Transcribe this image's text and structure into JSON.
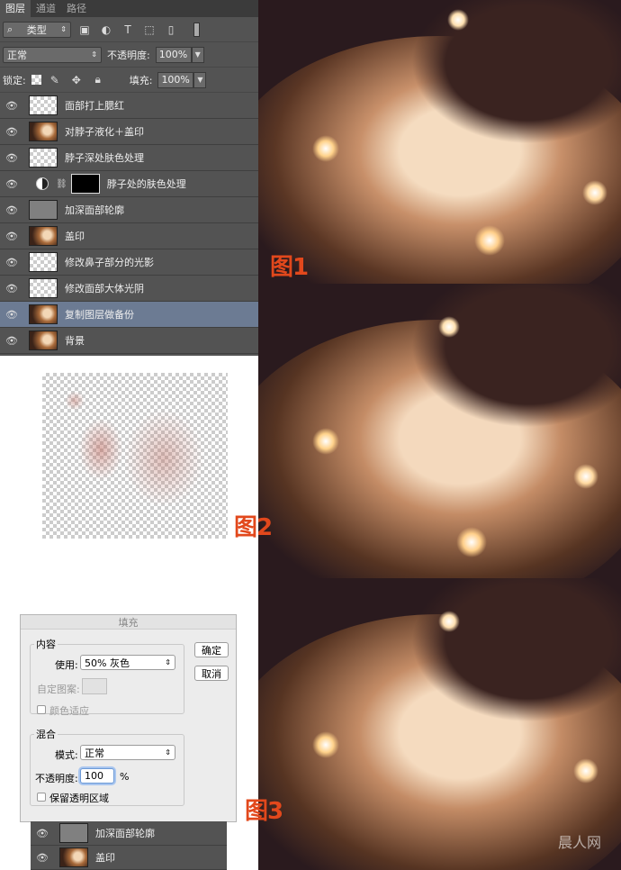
{
  "layers_panel": {
    "tabs": [
      "图层",
      "通道",
      "路径"
    ],
    "filter_kind": "类型",
    "blend_mode": "正常",
    "opacity_label": "不透明度:",
    "opacity_value": "100%",
    "lock_label": "锁定:",
    "fill_label": "填充:",
    "fill_value": "100%",
    "layers": [
      {
        "name": "面部打上腮红",
        "thumb": "transparent"
      },
      {
        "name": "对脖子液化＋盖印",
        "thumb": "photo"
      },
      {
        "name": "脖子深处肤色处理",
        "thumb": "transparent"
      },
      {
        "name": "脖子处的肤色处理",
        "thumb": "adjustment-mask"
      },
      {
        "name": "加深面部轮廓",
        "thumb": "gray"
      },
      {
        "name": "盖印",
        "thumb": "photo"
      },
      {
        "name": "修改鼻子部分的光影",
        "thumb": "transparent"
      },
      {
        "name": "修改面部大体光阴",
        "thumb": "transparent"
      },
      {
        "name": "复制图层做备份",
        "thumb": "photo",
        "selected": true
      },
      {
        "name": "背景",
        "thumb": "photo"
      }
    ]
  },
  "captions": {
    "fig1": "图1",
    "fig2": "图2",
    "fig3": "图3"
  },
  "fill_dialog": {
    "title": "填充",
    "content_legend": "内容",
    "use_label": "使用:",
    "use_value": "50% 灰色",
    "custom_pattern_label": "自定图案:",
    "color_adapt_label": "颜色适应",
    "blend_legend": "混合",
    "mode_label": "模式:",
    "mode_value": "正常",
    "opacity_label": "不透明度:",
    "opacity_value": "100",
    "percent": "%",
    "preserve_label": "保留透明区域",
    "ok": "确定",
    "cancel": "取消"
  },
  "mini_layers": [
    {
      "name": "加深面部轮廓",
      "thumb": "gray"
    },
    {
      "name": "盖印",
      "thumb": "photo"
    }
  ],
  "watermark": "晨人网"
}
